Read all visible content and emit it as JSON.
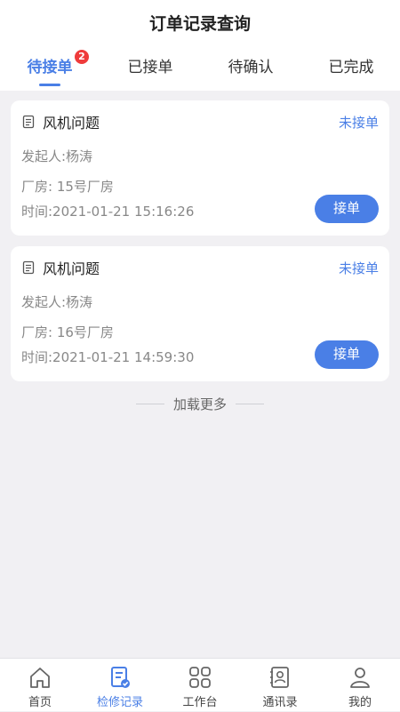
{
  "header": {
    "title": "订单记录查询"
  },
  "tabs": [
    {
      "label": "待接单",
      "badge": "2",
      "active": true
    },
    {
      "label": "已接单"
    },
    {
      "label": "待确认"
    },
    {
      "label": "已完成"
    }
  ],
  "orders": [
    {
      "title": "风机问题",
      "status": "未接单",
      "initiator": "发起人:杨涛",
      "plant": "厂房: 15号厂房",
      "time": "时间:2021-01-21 15:16:26",
      "action": "接单"
    },
    {
      "title": "风机问题",
      "status": "未接单",
      "initiator": "发起人:杨涛",
      "plant": "厂房: 16号厂房",
      "time": "时间:2021-01-21 14:59:30",
      "action": "接单"
    }
  ],
  "load_more": "加载更多",
  "bottom_nav": [
    {
      "label": "首页",
      "icon": "home-icon"
    },
    {
      "label": "检修记录",
      "icon": "record-icon",
      "active": true
    },
    {
      "label": "工作台",
      "icon": "grid-icon"
    },
    {
      "label": "通讯录",
      "icon": "contacts-icon"
    },
    {
      "label": "我的",
      "icon": "user-icon"
    }
  ],
  "colors": {
    "accent": "#4a7fe6",
    "badge": "#ef3b3b",
    "background": "#f1f0f3"
  }
}
